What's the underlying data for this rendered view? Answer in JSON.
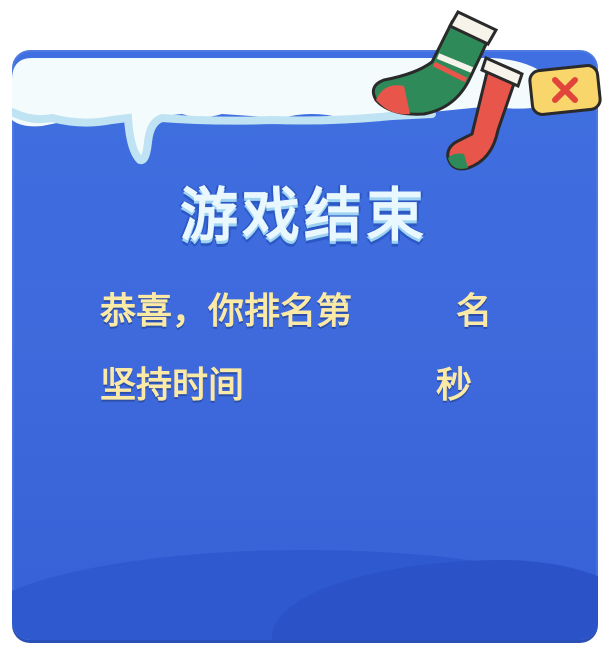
{
  "dialog": {
    "title": "游戏结束",
    "rank_prefix": "恭喜，你排名第",
    "rank_value": "",
    "rank_suffix": "名",
    "time_label": "坚持时间",
    "time_value": "",
    "time_unit": "秒"
  },
  "close_button": {
    "icon": "close-icon"
  },
  "colors": {
    "panel": "#3f6fe0",
    "text": "#fbe9a6",
    "title": "#e9f7ff",
    "close_bg": "#f8d66b",
    "close_x": "#e0443a"
  }
}
